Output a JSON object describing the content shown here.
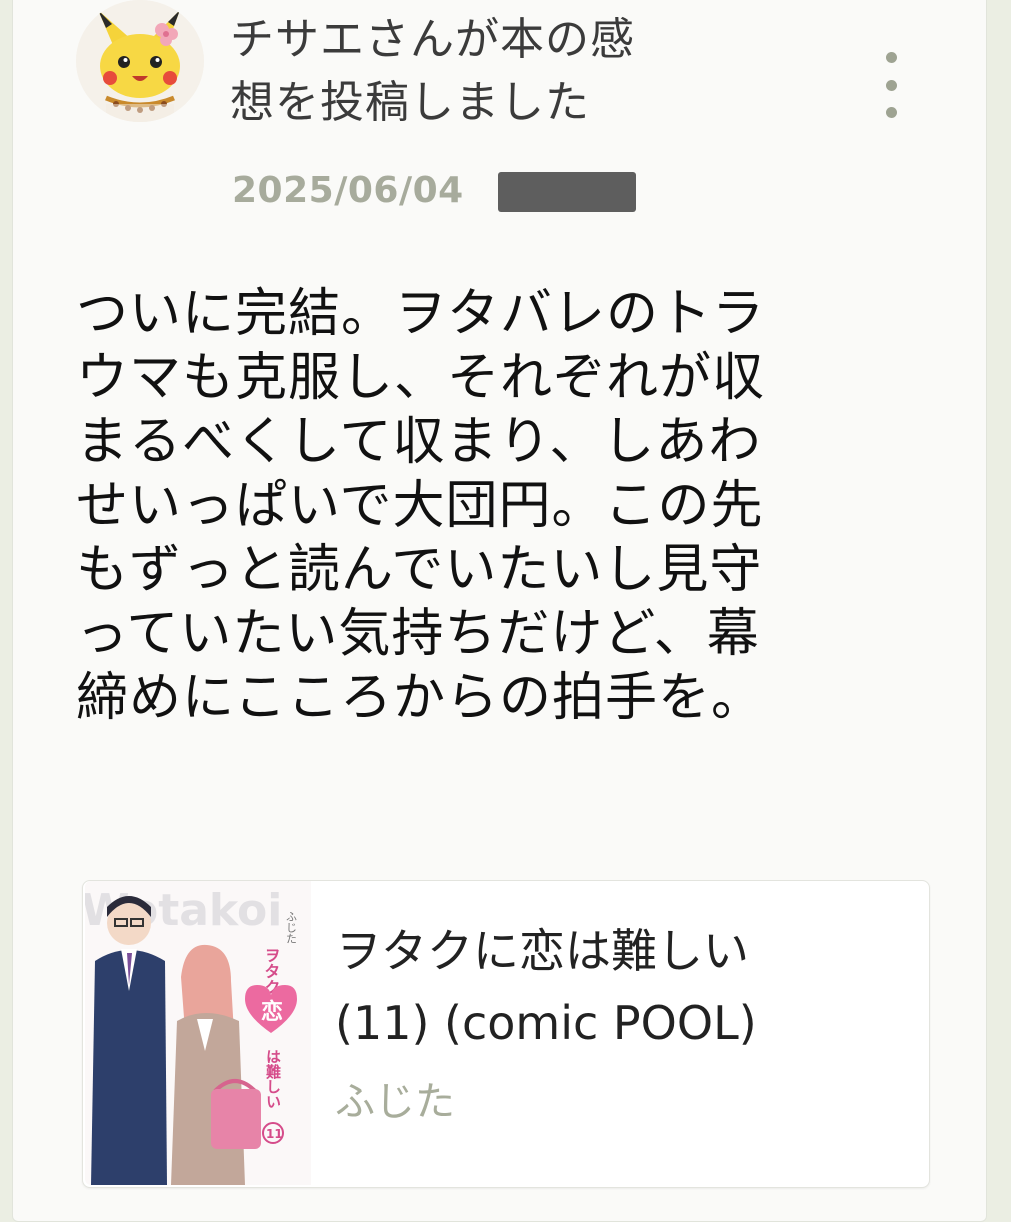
{
  "post": {
    "title": "チサエさんが本の感\n想を投稿しました",
    "date": "2025/06/04",
    "menu_icon": "more-vertical-icon",
    "body": "ついに完結。ヲタバレのトラ\nウマも克服し、それぞれが収\nまるべくして収まり、しあわ\nせいっぱいで大団円。この先\nもずっと読んでいたいし見守\nっていたい気持ちだけど、幕\n締めにこころからの拍手を。"
  },
  "book": {
    "title": "ヲタクに恋は難しい\n(11) (comic POOL)",
    "author": "ふじた",
    "cover_text": {
      "vertical_title": "ヲタクに",
      "koi": "恋",
      "rest": "は難しい",
      "volume": "11",
      "author": "ふじた",
      "romaji": "Wotakoi"
    }
  },
  "colors": {
    "background": "#ebeee3",
    "card": "#fafaf8",
    "muted": "#a7ab9c",
    "cover_pink": "#ec6aa0"
  }
}
